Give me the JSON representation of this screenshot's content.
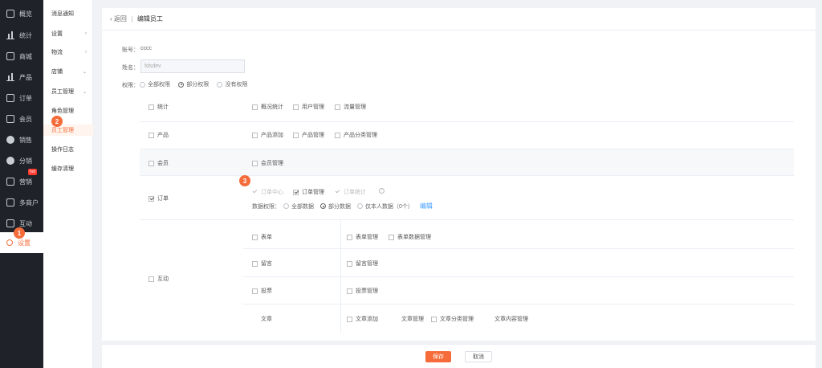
{
  "sidebar": {
    "items": [
      {
        "label": "概览",
        "icon": "layers-icon"
      },
      {
        "label": "统计",
        "icon": "bar-chart-icon"
      },
      {
        "label": "商城",
        "icon": "store-icon"
      },
      {
        "label": "产品",
        "icon": "product-icon"
      },
      {
        "label": "订单",
        "icon": "order-icon"
      },
      {
        "label": "会员",
        "icon": "crown-icon"
      },
      {
        "label": "销售",
        "icon": "sales-icon"
      },
      {
        "label": "分销",
        "icon": "distribution-icon"
      },
      {
        "label": "营销",
        "icon": "marketing-icon",
        "badge": "hot"
      },
      {
        "label": "多商户",
        "icon": "merchant-icon"
      },
      {
        "label": "互动",
        "icon": "interaction-icon"
      },
      {
        "label": "设置",
        "icon": "gear-icon"
      }
    ]
  },
  "submenu": {
    "items": [
      {
        "label": "消息通知",
        "arrow": ""
      },
      {
        "label": "设置",
        "arrow": "›"
      },
      {
        "label": "物流",
        "arrow": "›"
      },
      {
        "label": "店铺",
        "arrow": "⌄"
      },
      {
        "label": "员工管理",
        "arrow": "⌄"
      },
      {
        "label": "角色管理",
        "arrow": ""
      },
      {
        "label": "员工管理",
        "arrow": ""
      },
      {
        "label": "操作日志",
        "arrow": ""
      },
      {
        "label": "缓存清理",
        "arrow": ""
      }
    ]
  },
  "badges": [
    "1",
    "2",
    "3"
  ],
  "header": {
    "back": "返回",
    "title": "编辑员工"
  },
  "form": {
    "account_label": "账号：",
    "account_value": "cccc",
    "name_label": "姓名：",
    "name_value": "fdsdev",
    "perm_label": "权限：",
    "perm_options": [
      "全部权限",
      "部分权限",
      "没有权限"
    ]
  },
  "perm_table": {
    "stats": {
      "label": "统计",
      "items": [
        "概况统计",
        "用户管理",
        "流量管理"
      ]
    },
    "product": {
      "label": "产品",
      "items": [
        "产品添加",
        "产品管理",
        "产品分类管理"
      ]
    },
    "member": {
      "label": "会员",
      "items": [
        "会员管理"
      ]
    },
    "order": {
      "label": "订单",
      "items": [
        "订单中心",
        "订单管理",
        "订单统计"
      ],
      "data_label": "数据权限：",
      "data_options": [
        "全部数据",
        "部分数据",
        "仅本人数据（0个）"
      ],
      "edit": "编辑"
    },
    "interaction": {
      "label": "互动",
      "rows": [
        {
          "label": "表单",
          "items": [
            "表单管理",
            "表单数据管理"
          ]
        },
        {
          "label": "留言",
          "items": [
            "留言管理"
          ]
        },
        {
          "label": "投票",
          "items": [
            "投票管理"
          ]
        },
        {
          "label": "文章",
          "items": [
            "文章添加",
            "文章管理",
            "文章分类管理",
            "文章内容管理"
          ]
        }
      ]
    }
  },
  "footer": {
    "save": "保存",
    "cancel": "取消"
  },
  "colors": {
    "accent": "#f56c3a",
    "sidebar_bg": "#1f2329",
    "link": "#409eff"
  }
}
